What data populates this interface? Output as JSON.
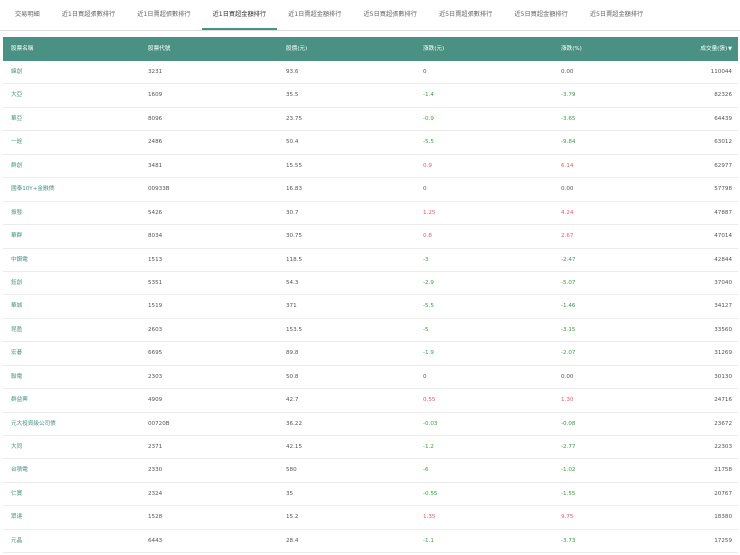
{
  "tabs": [
    {
      "label": "交易明細",
      "active": false
    },
    {
      "label": "近1日買超張數排行",
      "active": false
    },
    {
      "label": "近1日賣超張數排行",
      "active": false
    },
    {
      "label": "近1日買超金額排行",
      "active": true
    },
    {
      "label": "近1日賣超金額排行",
      "active": false
    },
    {
      "label": "近5日買超張數排行",
      "active": false
    },
    {
      "label": "近5日賣超張數排行",
      "active": false
    },
    {
      "label": "近5日買超金額排行",
      "active": false
    },
    {
      "label": "近5日賣超金額排行",
      "active": false
    }
  ],
  "columns": [
    "股票名稱",
    "股票代號",
    "股價(元)",
    "漲跌(元)",
    "漲跌(%)",
    "成交量(張)"
  ],
  "sort_icon": "▼",
  "colors": {
    "accent": "#4a9183",
    "up": "#e05a6d",
    "down": "#3f9a4a"
  },
  "rows": [
    [
      "緯創",
      "3231",
      "93.6",
      "0",
      "0.00",
      "110044"
    ],
    [
      "大亞",
      "1609",
      "35.5",
      "-1.4",
      "-3.79",
      "82326"
    ],
    [
      "華亞",
      "8096",
      "23.75",
      "-0.9",
      "-3.65",
      "64439"
    ],
    [
      "一詮",
      "2486",
      "50.4",
      "-5.5",
      "-9.84",
      "63012"
    ],
    [
      "群創",
      "3481",
      "15.55",
      "0.9",
      "6.14",
      "62977"
    ],
    [
      "國泰10Y+金融債",
      "00933B",
      "16.83",
      "0",
      "0.00",
      "57798"
    ],
    [
      "振發",
      "5426",
      "30.7",
      "1.25",
      "4.24",
      "47887"
    ],
    [
      "華群",
      "8034",
      "30.75",
      "0.8",
      "2.67",
      "47014"
    ],
    [
      "中鋼電",
      "1513",
      "118.5",
      "-3",
      "-2.47",
      "42844"
    ],
    [
      "鈺創",
      "5351",
      "54.3",
      "-2.9",
      "-5.07",
      "37040"
    ],
    [
      "華城",
      "1519",
      "371",
      "-5.5",
      "-1.46",
      "34127"
    ],
    [
      "昆盈",
      "2603",
      "153.5",
      "-5",
      "-3.15",
      "33560"
    ],
    [
      "宏碁",
      "6695",
      "89.8",
      "-1.9",
      "-2.07",
      "31269"
    ],
    [
      "聯電",
      "2303",
      "50.8",
      "0",
      "0.00",
      "30130"
    ],
    [
      "群益興",
      "4909",
      "42.7",
      "0.55",
      "1.30",
      "24716"
    ],
    [
      "元大投資級公司債",
      "00720B",
      "36.22",
      "-0.03",
      "-0.08",
      "23672"
    ],
    [
      "大同",
      "2371",
      "42.15",
      "-1.2",
      "-2.77",
      "22303"
    ],
    [
      "台積電",
      "2330",
      "580",
      "-6",
      "-1.02",
      "21758"
    ],
    [
      "仁寶",
      "2324",
      "35",
      "-0.55",
      "-1.55",
      "20767"
    ],
    [
      "眾達",
      "1528",
      "15.2",
      "1.35",
      "9.75",
      "18380"
    ],
    [
      "元晶",
      "6443",
      "28.4",
      "-1.1",
      "-3.73",
      "17259"
    ]
  ]
}
